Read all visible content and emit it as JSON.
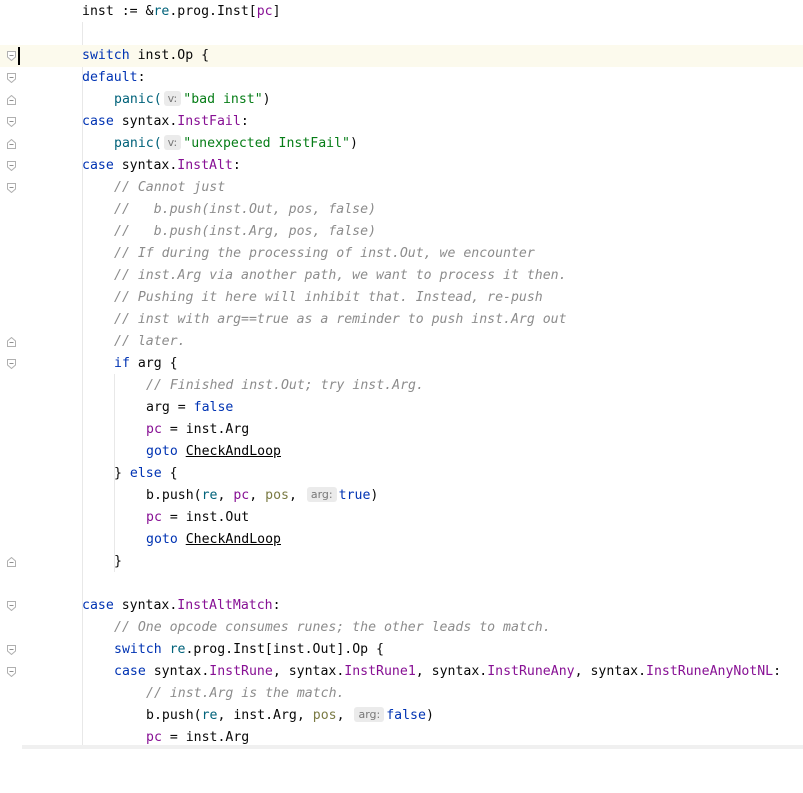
{
  "hints": {
    "v": "v:",
    "arg": "arg:"
  },
  "lines": {
    "l1": {
      "a": "inst := &",
      "b": "re",
      "c": ".prog.Inst[",
      "d": "pc",
      "e": "]"
    },
    "l3": {
      "kw": "switch",
      "rest": " inst.Op {"
    },
    "l4": {
      "kw": "default",
      "rest": ":"
    },
    "l5": {
      "fn": "panic(",
      "str": "\"bad inst\"",
      "end": ")"
    },
    "l6": {
      "kw": "case",
      "pkg": " syntax.",
      "field": "InstFail",
      "end": ":"
    },
    "l7": {
      "fn": "panic(",
      "str": "\"unexpected InstFail\"",
      "end": ")"
    },
    "l8": {
      "kw": "case",
      "pkg": " syntax.",
      "field": "InstAlt",
      "end": ":"
    },
    "c1": "// Cannot just",
    "c2": "//   b.push(inst.Out, pos, false)",
    "c3": "//   b.push(inst.Arg, pos, false)",
    "c4": "// If during the processing of inst.Out, we encounter",
    "c5": "// inst.Arg via another path, we want to process it then.",
    "c6": "// Pushing it here will inhibit that. Instead, re-push",
    "c7": "// inst with arg==true as a reminder to push inst.Arg out",
    "c8": "// later.",
    "l17": {
      "kw": "if",
      "rest": " arg {"
    },
    "c9": "// Finished inst.Out; try inst.Arg.",
    "l19": {
      "a": "arg = ",
      "kw": "false"
    },
    "l20": {
      "pc": "pc",
      "rest": " = inst.Arg"
    },
    "l21": {
      "kw": "goto",
      "label": "CheckAndLoop"
    },
    "l22": {
      "a": "} ",
      "kw": "else",
      "rest": " {"
    },
    "l23": {
      "a": "b.push(",
      "re": "re",
      "s1": ", ",
      "pc": "pc",
      "s2": ", ",
      "pos": "pos",
      "s3": ", ",
      "kw": "true",
      "end": ")"
    },
    "l24": {
      "pc": "pc",
      "rest": " = inst.Out"
    },
    "l25": {
      "kw": "goto",
      "label": "CheckAndLoop"
    },
    "l26": "}",
    "l28": {
      "kw": "case",
      "pkg": " syntax.",
      "field": "InstAltMatch",
      "end": ":"
    },
    "c10": "// One opcode consumes runes; the other leads to match.",
    "l30": {
      "kw": "switch",
      "sp": " ",
      "re": "re",
      "rest": ".prog.Inst[inst.Out].Op {"
    },
    "l31": {
      "kw": "case",
      "p1": " syntax.",
      "f1": "InstRune",
      "p2": ", syntax.",
      "f2": "InstRune1",
      "p3": ", syntax.",
      "f3": "InstRuneAny",
      "p4": ", syntax.",
      "f4": "InstRuneAnyNotNL",
      "end": ":"
    },
    "c11": "// inst.Arg is the match.",
    "l33": {
      "a": "b.push(",
      "re": "re",
      "s1": ", inst.Arg, ",
      "pos": "pos",
      "s2": ", ",
      "kw": "false",
      "end": ")"
    },
    "l34": {
      "pc": "pc",
      "rest": " = inst.Arg"
    }
  }
}
